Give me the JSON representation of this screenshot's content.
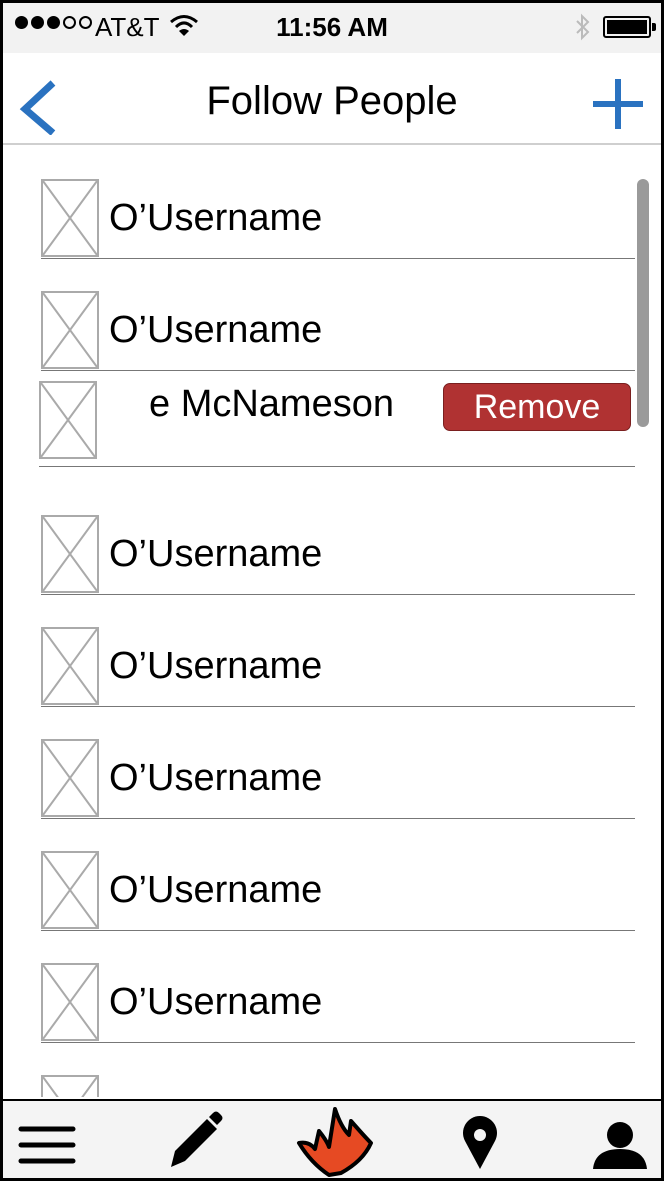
{
  "status_bar": {
    "carrier": "AT&T",
    "time": "11:56 AM",
    "signal_filled": 3,
    "signal_total": 5
  },
  "nav": {
    "title": "Follow People",
    "back_icon": "chevron-left-icon",
    "add_icon": "plus-icon",
    "accent_color": "#2a72c0"
  },
  "list": {
    "rows": [
      {
        "name": "O’Username"
      },
      {
        "name": "O’Username"
      },
      {
        "name": "e McNameson",
        "action": "Remove"
      },
      {
        "name": "O’Username"
      },
      {
        "name": "O’Username"
      },
      {
        "name": "O’Username"
      },
      {
        "name": "O’Username"
      },
      {
        "name": "O’Username"
      }
    ],
    "remove_color": "#b03232"
  },
  "tab_bar": {
    "items": [
      "menu-icon",
      "pencil-icon",
      "fire-icon",
      "map-pin-icon",
      "person-icon"
    ],
    "fire_color": "#e64a23"
  }
}
